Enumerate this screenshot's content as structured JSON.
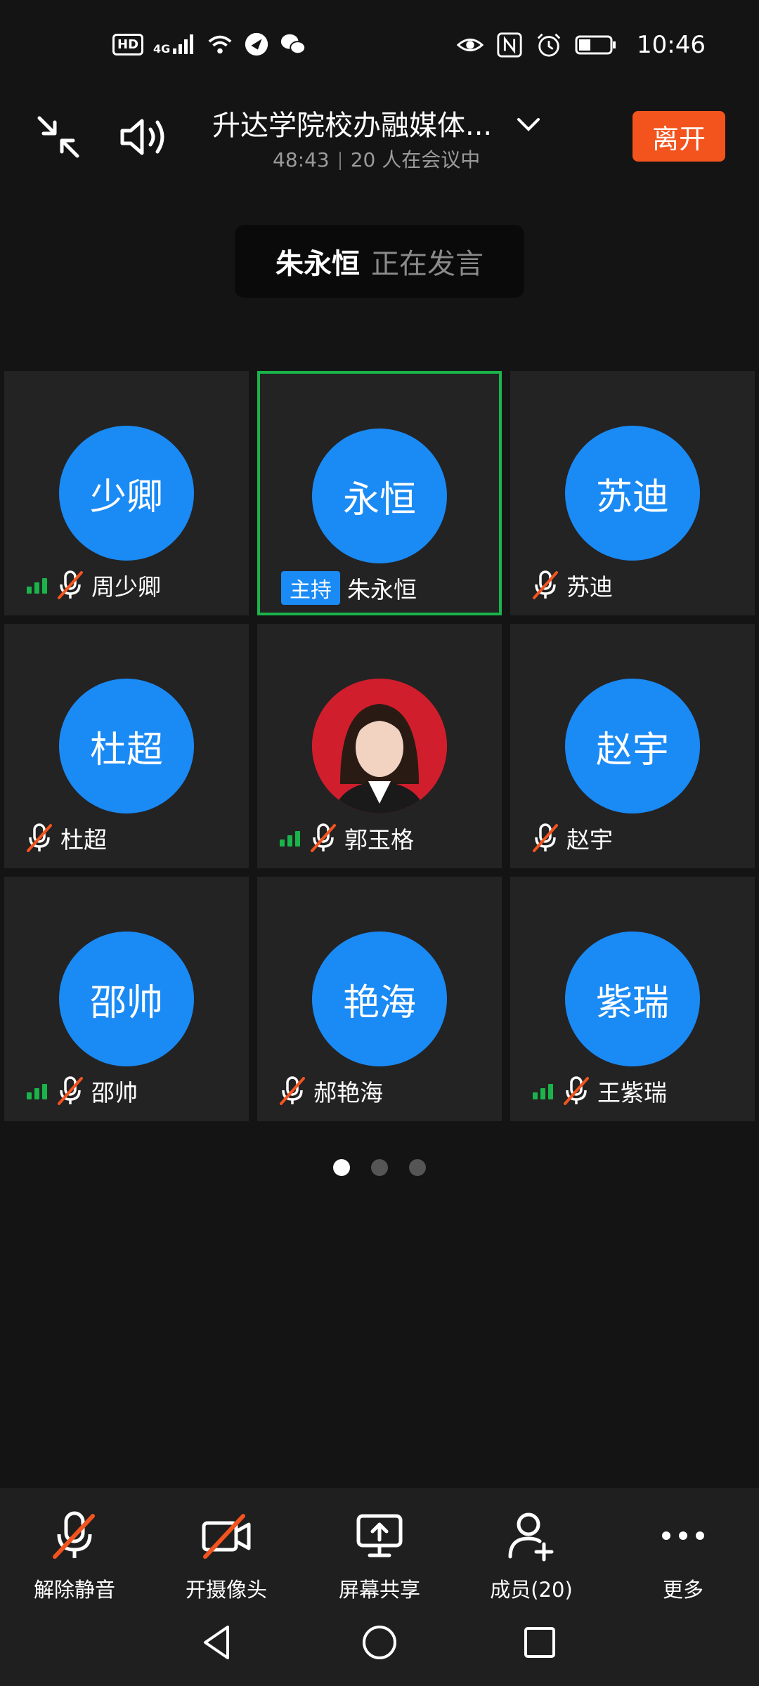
{
  "status_bar": {
    "time": "10:46",
    "left_icons": [
      "hd-icon",
      "4g-signal-icon",
      "wifi-icon",
      "app-notification-icon",
      "wechat-icon"
    ],
    "hd_label": "HD",
    "net_label": "4G",
    "right_icons": [
      "eye-icon",
      "nfc-icon",
      "alarm-icon",
      "battery-icon"
    ]
  },
  "header": {
    "title": "升达学院校办融媒体...",
    "duration": "48:43",
    "participants_text": "20 人在会议中",
    "leave_label": "离开"
  },
  "speaker": {
    "name": "朱永恒",
    "status": "正在发言"
  },
  "tiles": [
    {
      "avatar_text": "少卿",
      "name": "周少卿",
      "signal": true,
      "muted": true,
      "host": false,
      "photo": false
    },
    {
      "avatar_text": "永恒",
      "name": "朱永恒",
      "signal": false,
      "muted": false,
      "host": true,
      "photo": false
    },
    {
      "avatar_text": "苏迪",
      "name": "苏迪",
      "signal": false,
      "muted": true,
      "host": false,
      "photo": false
    },
    {
      "avatar_text": "杜超",
      "name": "杜超",
      "signal": false,
      "muted": true,
      "host": false,
      "photo": false
    },
    {
      "avatar_text": "",
      "name": "郭玉格",
      "signal": true,
      "muted": true,
      "host": false,
      "photo": true
    },
    {
      "avatar_text": "赵宇",
      "name": "赵宇",
      "signal": false,
      "muted": true,
      "host": false,
      "photo": false
    },
    {
      "avatar_text": "邵帅",
      "name": "邵帅",
      "signal": true,
      "muted": true,
      "host": false,
      "photo": false
    },
    {
      "avatar_text": "艳海",
      "name": "郝艳海",
      "signal": false,
      "muted": true,
      "host": false,
      "photo": false
    },
    {
      "avatar_text": "紫瑞",
      "name": "王紫瑞",
      "signal": true,
      "muted": true,
      "host": false,
      "photo": false
    }
  ],
  "host_badge_label": "主持",
  "pager": {
    "pages": 3,
    "current": 1
  },
  "toolbar": {
    "unmute": "解除静音",
    "camera": "开摄像头",
    "share": "屏幕共享",
    "members": "成员(20)",
    "more": "更多"
  },
  "colors": {
    "background": "#141414",
    "tile": "#232323",
    "avatar": "#1a8af5",
    "leave": "#f3541e",
    "active_border": "#1ab44a",
    "mute_slash": "#f3541e",
    "signal": "#1ab44a"
  }
}
